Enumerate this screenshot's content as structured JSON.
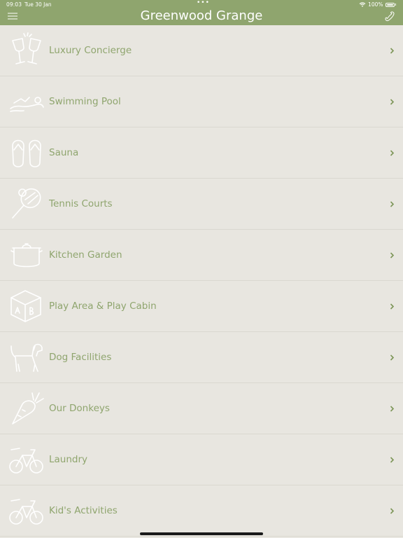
{
  "status_bar": {
    "time": "09:03",
    "date": "Tue 30 Jan",
    "dots": "•••",
    "battery": "100%"
  },
  "nav": {
    "title": "Greenwood Grange"
  },
  "colors": {
    "header": "#8fa56e",
    "background": "#e8e6e0",
    "label": "#8fa56e",
    "chevron": "#7d9658"
  },
  "items": [
    {
      "label": "Luxury Concierge",
      "icon": "champagne-glasses-icon"
    },
    {
      "label": "Swimming Pool",
      "icon": "swimmer-icon"
    },
    {
      "label": "Sauna",
      "icon": "flip-flops-icon"
    },
    {
      "label": "Tennis Courts",
      "icon": "tennis-racket-icon"
    },
    {
      "label": "Kitchen Garden",
      "icon": "cooking-pot-icon"
    },
    {
      "label": "Play Area & Play Cabin",
      "icon": "toy-block-icon"
    },
    {
      "label": "Dog Facilities",
      "icon": "dog-icon"
    },
    {
      "label": "Our Donkeys",
      "icon": "carrot-icon"
    },
    {
      "label": "Laundry",
      "icon": "bicycle-icon"
    },
    {
      "label": "Kid's Activities",
      "icon": "bicycle-icon"
    }
  ]
}
